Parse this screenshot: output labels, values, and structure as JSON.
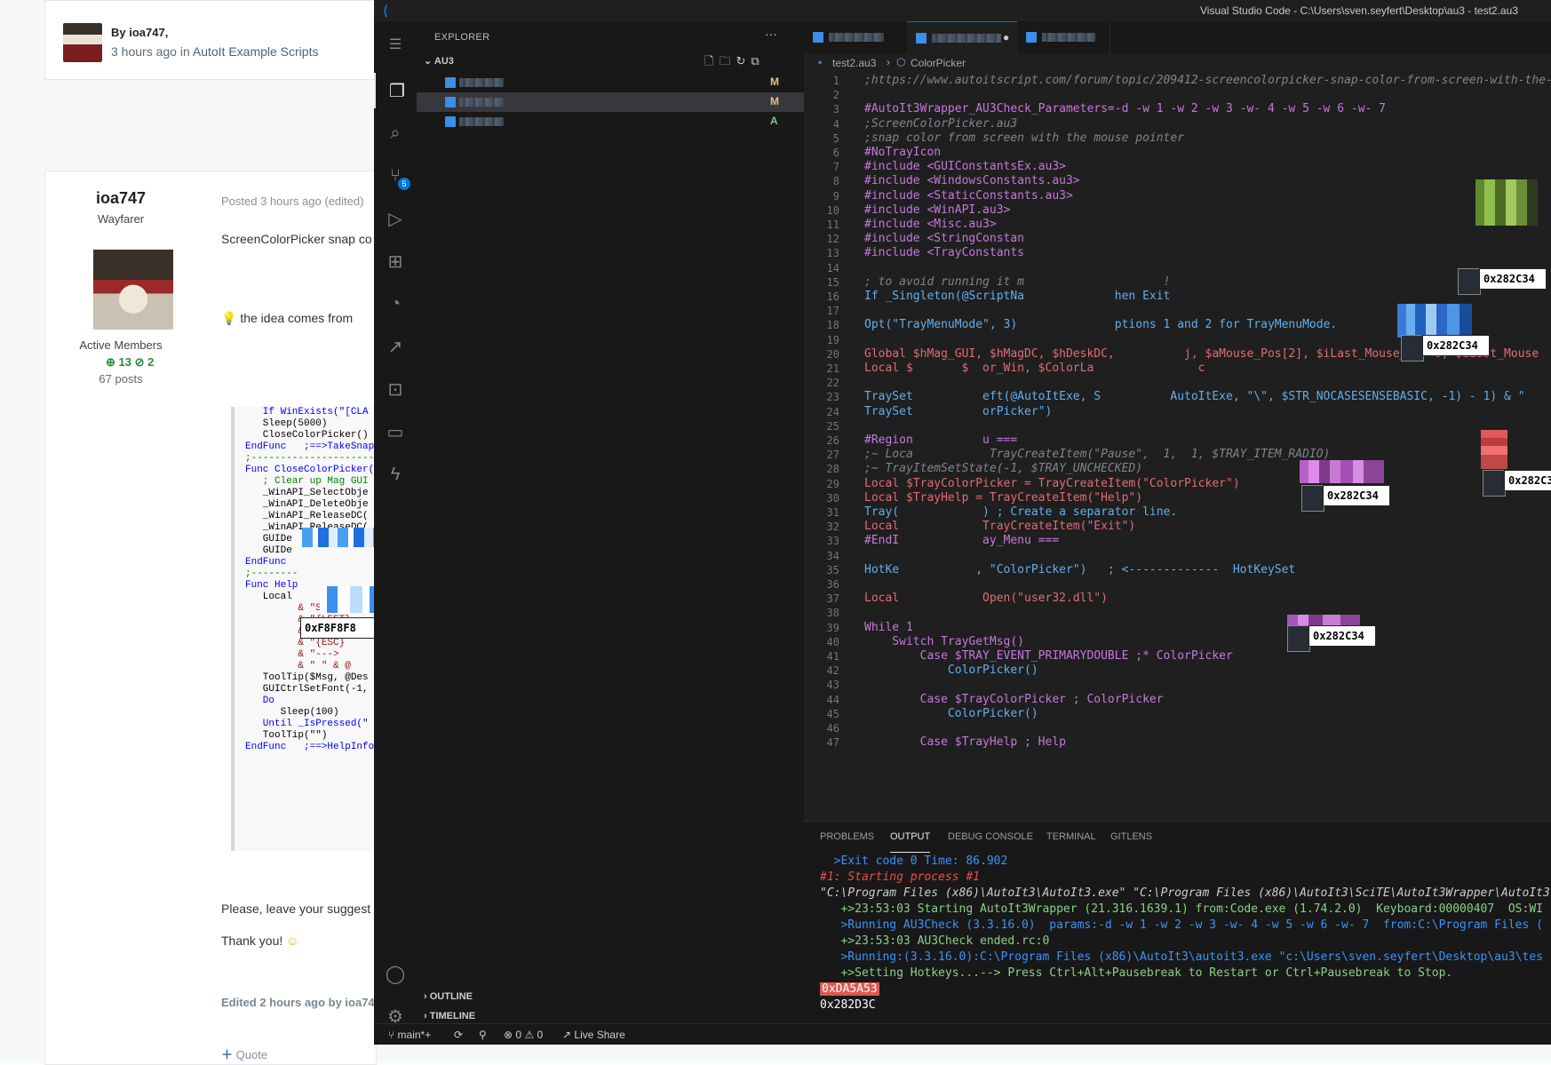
{
  "forum": {
    "top_author": "By ioa747,",
    "top_time": "3 hours ago in",
    "top_forum": "AutoIt Example Scripts",
    "username": "ioa747",
    "rank": "Wayfarer",
    "member_group": "Active Members",
    "rep_pos": "13",
    "rep_check": "2",
    "posts": "67 posts",
    "posted": "Posted 3 hours ago (edited)",
    "post_line1": "ScreenColorPicker  snap co",
    "idea_line": "the idea comes from",
    "suggest_line": "Please, leave your suggest",
    "thanks_line": "Thank you!",
    "edited_line": "Edited 2 hours ago by ioa74",
    "quote_label": "Quote",
    "code_lines": [
      "   If WinExists(\"[CLA",
      "   Sleep(5000)",
      "   CloseColorPicker()",
      "EndFunc   ;==>TakeSnap",
      ";-----------------------",
      "Func CloseColorPicker(",
      "   ; Clear up Mag GUI",
      "   _WinAPI_SelectObje",
      "   _WinAPI_DeleteObje",
      "   _WinAPI_ReleaseDC(",
      "   _WinAPI_ReleaseDC(",
      "   GUIDe",
      "   GUIDe",
      "EndFunc",
      ";--------",
      "Func Help",
      "",
      "   Local",
      "",
      "",
      "         & \"Snap",
      "         & \"{LEFT}",
      "         & \"moves",
      "         & \"{ESC}",
      "         & \"--->",
      "         & \" \" & @",
      "",
      "   ToolTip($Msg, @Des",
      "   GUICtrlSetFont(-1,",
      "",
      "   Do",
      "      Sleep(100)",
      "   Until _IsPressed(\"",
      "",
      "   ToolTip(\"\")",
      "",
      "EndFunc   ;==>HelpInfo"
    ],
    "forum_tip": "0xF8F8F8"
  },
  "vscode": {
    "window_title": "Visual Studio Code - C:\\Users\\sven.seyfert\\Desktop\\au3 - test2.au3",
    "explorer_title": "EXPLORER",
    "explorer_more": "···",
    "folder_name": "AU3",
    "files": [
      {
        "status": "M",
        "status_color": "#e2c08d"
      },
      {
        "status": "M",
        "status_color": "#e2c08d"
      },
      {
        "status": "A",
        "status_color": "#73c991"
      }
    ],
    "source_control_badge": "5",
    "outline_label": "OUTLINE",
    "timeline_label": "TIMELINE",
    "breadcrumb_file": "test2.au3",
    "breadcrumb_symbol": "ColorPicker",
    "code": [
      {
        "n": "1",
        "t": ";https://www.autoitscript.com/forum/topic/209412-screencolorpicker-snap-color-from-screen-with-the-",
        "c": "cm"
      },
      {
        "n": "2",
        "t": "",
        "c": ""
      },
      {
        "n": "3",
        "t": "#AutoIt3Wrapper_AU3Check_Parameters=-d -w 1 -w 2 -w 3 -w- 4 -w 5 -w 6 -w- 7",
        "c": "pp"
      },
      {
        "n": "4",
        "t": ";ScreenColorPicker.au3",
        "c": "cm"
      },
      {
        "n": "5",
        "t": ";snap color from screen with the mouse pointer",
        "c": "cm"
      },
      {
        "n": "6",
        "t": "#NoTrayIcon",
        "c": "pp"
      },
      {
        "n": "7",
        "t": "#include <GUIConstantsEx.au3>",
        "c": "pp"
      },
      {
        "n": "8",
        "t": "#include <WindowsConstants.au3>",
        "c": "pp"
      },
      {
        "n": "9",
        "t": "#include <StaticConstants.au3>",
        "c": "pp"
      },
      {
        "n": "10",
        "t": "#include <WinAPI.au3>",
        "c": "pp"
      },
      {
        "n": "11",
        "t": "#include <Misc.au3>",
        "c": "pp"
      },
      {
        "n": "12",
        "t": "#include <StringConstan",
        "c": "pp"
      },
      {
        "n": "13",
        "t": "#include <TrayConstants",
        "c": "pp"
      },
      {
        "n": "14",
        "t": "",
        "c": ""
      },
      {
        "n": "15",
        "t": "; to avoid running it m                    !",
        "c": "cm"
      },
      {
        "n": "16",
        "t": "If _Singleton(@ScriptNa             hen Exit",
        "c": "fn"
      },
      {
        "n": "17",
        "t": "",
        "c": ""
      },
      {
        "n": "18",
        "t": "Opt(\"TrayMenuMode\", 3)              ptions 1 and 2 for TrayMenuMode.",
        "c": "fn"
      },
      {
        "n": "19",
        "t": "",
        "c": ""
      },
      {
        "n": "20",
        "t": "Global $hMag_GUI, $hMagDC, $hDeskDC,          j, $aMouse_Pos[2], $iLast_Mouse_X = 0, $iLast_Mouse",
        "c": "vr"
      },
      {
        "n": "21",
        "t": "Local $       $  or_Win, $ColorLa               c",
        "c": "vr"
      },
      {
        "n": "22",
        "t": "",
        "c": ""
      },
      {
        "n": "23",
        "t": "TraySet          eft(@AutoItExe, S          AutoItExe, \"\\\", $STR_NOCASESENSEBASIC, -1) - 1) & \"",
        "c": "fn"
      },
      {
        "n": "24",
        "t": "TraySet          orPicker\")",
        "c": "fn"
      },
      {
        "n": "25",
        "t": "",
        "c": ""
      },
      {
        "n": "26",
        "t": "#Region          u ===",
        "c": "pp"
      },
      {
        "n": "27",
        "t": ";~ Loca           TrayCreateItem(\"Pause\",  1,  1, $TRAY_ITEM_RADIO)",
        "c": "cm"
      },
      {
        "n": "28",
        "t": ";~ TrayItemSetState(-1, $TRAY_UNCHECKED)",
        "c": "cm"
      },
      {
        "n": "29",
        "t": "Local $TrayColorPicker = TrayCreateItem(\"ColorPicker\")",
        "c": "vr"
      },
      {
        "n": "30",
        "t": "Local $TrayHelp = TrayCreateItem(\"Help\")",
        "c": "vr"
      },
      {
        "n": "31",
        "t": "Tray(            ) ; Create a separator line.",
        "c": "fn"
      },
      {
        "n": "32",
        "t": "Local            TrayCreateItem(\"Exit\")",
        "c": "vr"
      },
      {
        "n": "33",
        "t": "#EndI            ay_Menu ===",
        "c": "pp"
      },
      {
        "n": "34",
        "t": "",
        "c": ""
      },
      {
        "n": "35",
        "t": "HotKe           , \"ColorPicker\")   ; <-------------  HotKeySet",
        "c": "fn"
      },
      {
        "n": "36",
        "t": "",
        "c": ""
      },
      {
        "n": "37",
        "t": "Local            Open(\"user32.dll\")",
        "c": "vr"
      },
      {
        "n": "38",
        "t": "",
        "c": ""
      },
      {
        "n": "39",
        "t": "While 1",
        "c": "kw"
      },
      {
        "n": "40",
        "t": "    Switch TrayGetMsg()",
        "c": "kw"
      },
      {
        "n": "41",
        "t": "        Case $TRAY_EVENT_PRIMARYDOUBLE ;* ColorPicker",
        "c": "kw"
      },
      {
        "n": "42",
        "t": "            ColorPicker()",
        "c": "fn"
      },
      {
        "n": "43",
        "t": "",
        "c": ""
      },
      {
        "n": "44",
        "t": "        Case $TrayColorPicker ; ColorPicker",
        "c": "kw"
      },
      {
        "n": "45",
        "t": "            ColorPicker()",
        "c": "fn"
      },
      {
        "n": "46",
        "t": "",
        "c": ""
      },
      {
        "n": "47",
        "t": "        Case $TrayHelp ; Help",
        "c": "kw"
      }
    ],
    "tooltips": [
      "0x282C34",
      "0x282C34",
      "0x282C34",
      "0x282C34",
      "0x282C34"
    ],
    "panel_tabs": [
      "PROBLEMS",
      "OUTPUT",
      "DEBUG CONSOLE",
      "TERMINAL",
      "GITLENS"
    ],
    "panel_active": "OUTPUT",
    "output": [
      {
        "t": "  >Exit code 0 Time: 86.902",
        "c": "o-blue"
      },
      {
        "t": "#1: Starting process #1",
        "c": "o-pink"
      },
      {
        "t": "\"C:\\Program Files (x86)\\AutoIt3\\AutoIt3.exe\" \"C:\\Program Files (x86)\\AutoIt3\\SciTE\\AutoIt3Wrapper\\AutoIt3",
        "c": "o-path"
      },
      {
        "t": "   +>23:53:03 Starting AutoIt3Wrapper (21.316.1639.1) from:Code.exe (1.74.2.0)  Keyboard:00000407  OS:WI",
        "c": "o-green"
      },
      {
        "t": "   >Running AU3Check (3.3.16.0)  params:-d -w 1 -w 2 -w 3 -w- 4 -w 5 -w 6 -w- 7  from:C:\\Program Files (",
        "c": "o-blue"
      },
      {
        "t": "   +>23:53:03 AU3Check ended.rc:0",
        "c": "o-green"
      },
      {
        "t": "   >Running:(3.3.16.0):C:\\Program Files (x86)\\AutoIt3\\autoit3.exe \"c:\\Users\\sven.seyfert\\Desktop\\au3\\tes",
        "c": "o-blue"
      },
      {
        "t": "   +>Setting Hotkeys...--> Press Ctrl+Alt+Pausebreak to Restart or Ctrl+Pausebreak to Stop.",
        "c": "o-green"
      }
    ],
    "out_color1": "0xDA5A53",
    "out_color2": "0x282D3C",
    "status_branch": "main*+",
    "status_errors": "0",
    "status_warnings": "0",
    "status_liveshare": "Live Share"
  }
}
